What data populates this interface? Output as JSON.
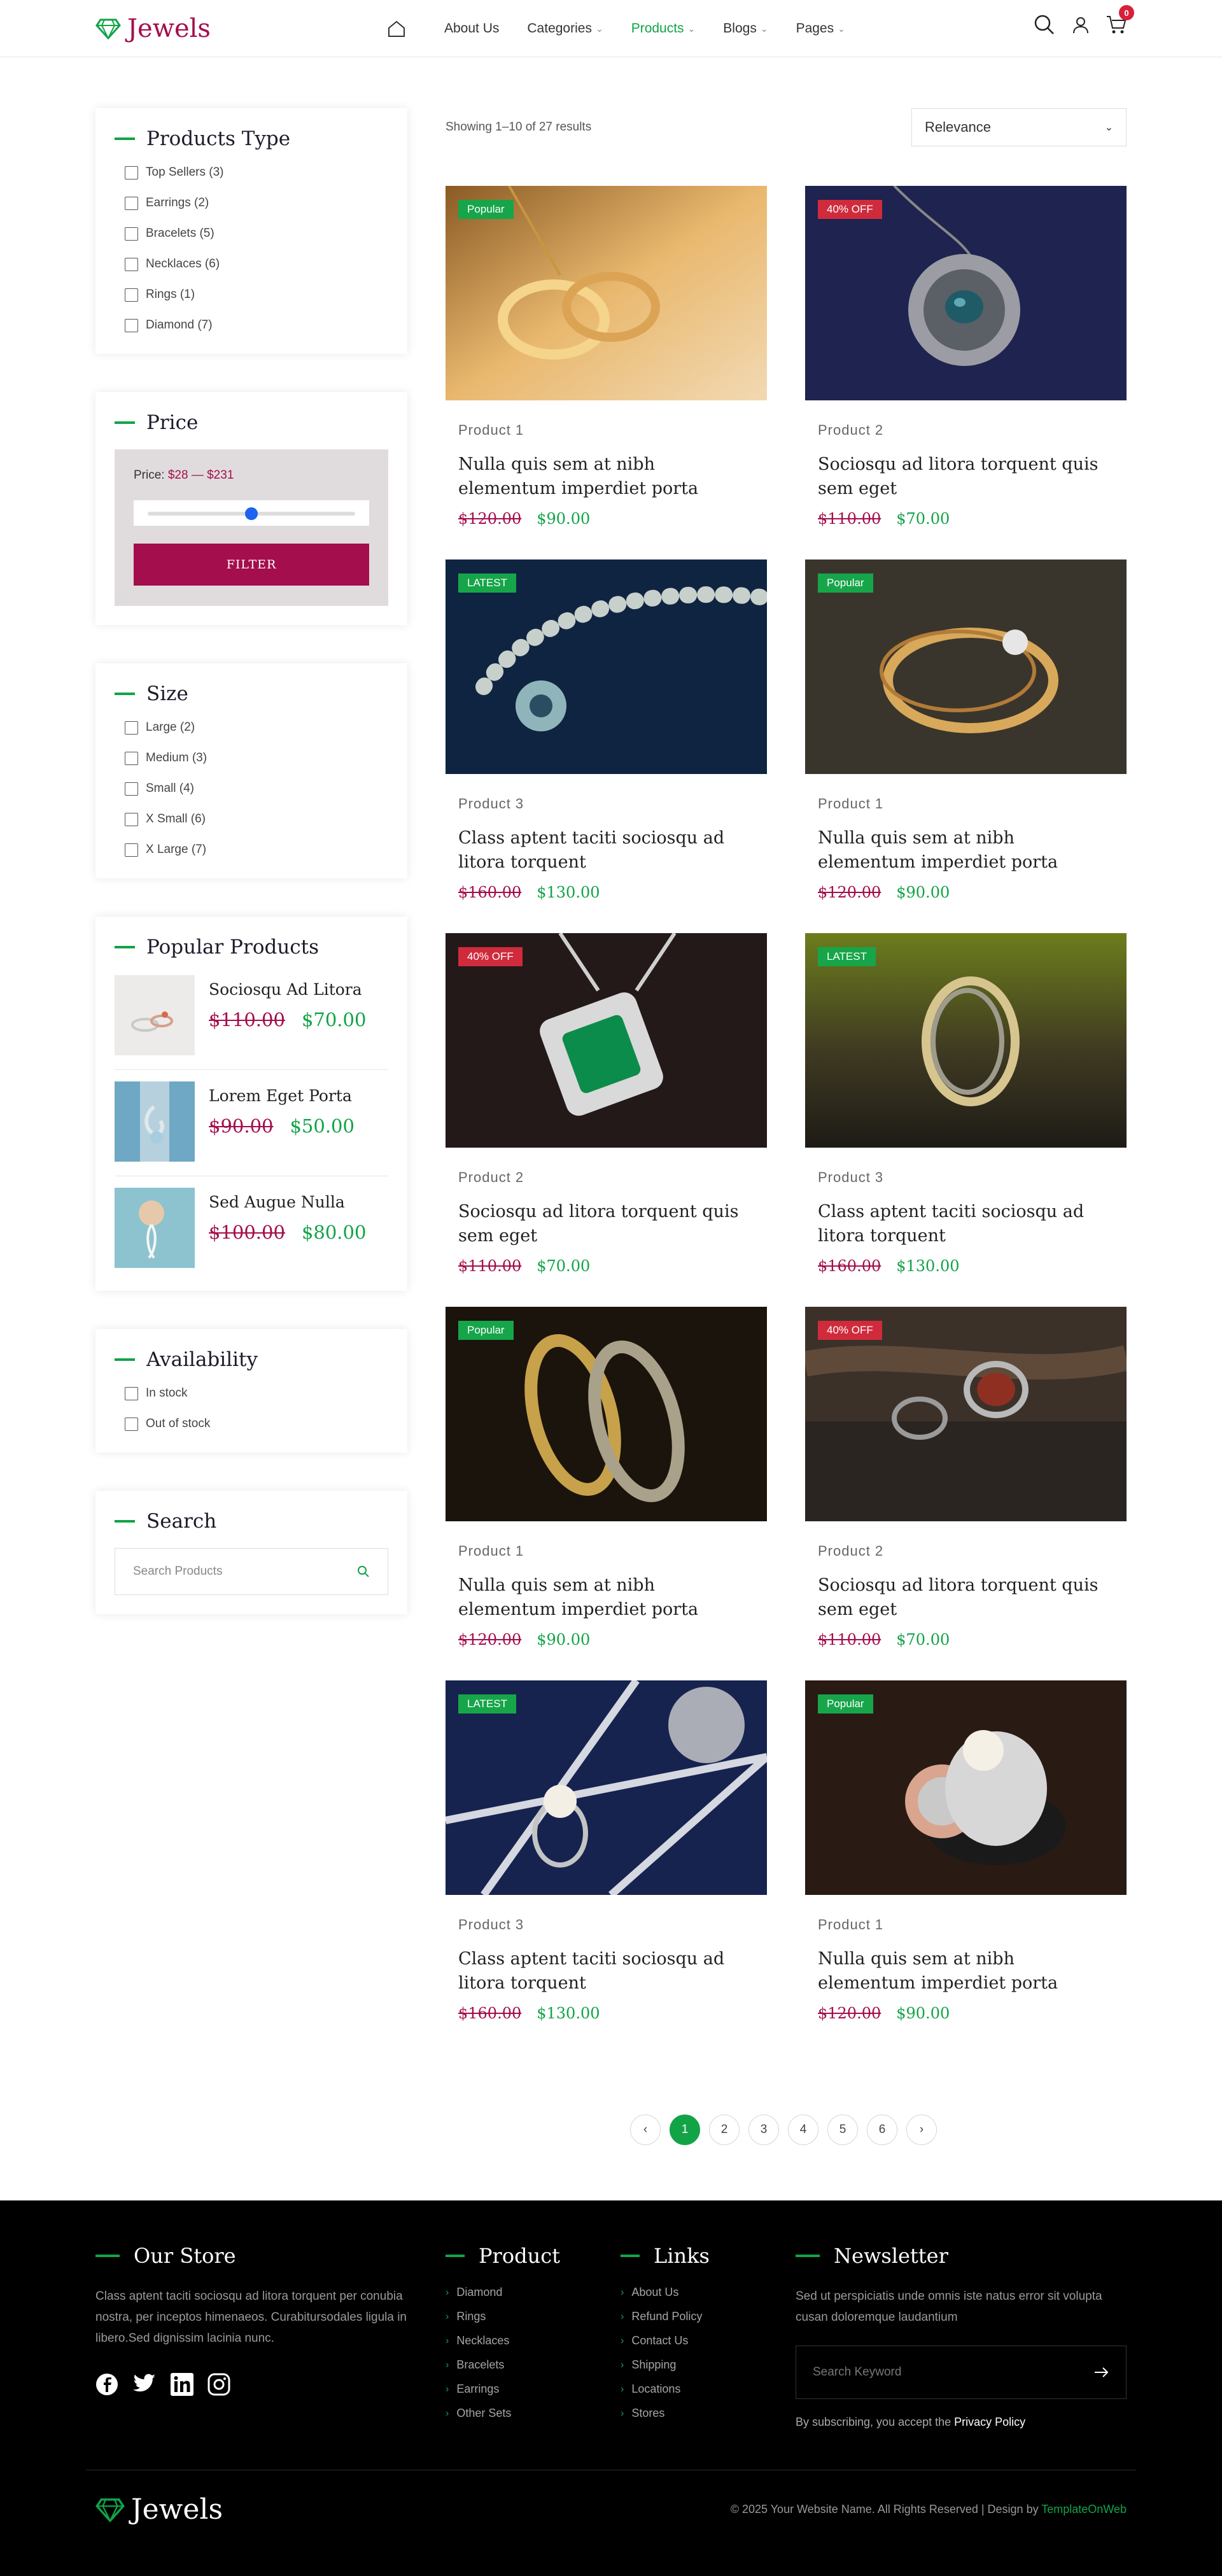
{
  "header": {
    "brand": "Jewels",
    "nav": [
      {
        "label": "About Us",
        "has_menu": false
      },
      {
        "label": "Categories",
        "has_menu": true
      },
      {
        "label": "Products",
        "has_menu": true,
        "active": true
      },
      {
        "label": "Blogs",
        "has_menu": true
      },
      {
        "label": "Pages",
        "has_menu": true
      }
    ],
    "cart_count": "0",
    "icons": [
      "home-icon",
      "search-icon",
      "user-icon",
      "cart-icon"
    ]
  },
  "sidebar": {
    "products_type": {
      "title": "Products Type",
      "options": [
        "Top Sellers (3)",
        "Earrings (2)",
        "Bracelets (5)",
        "Necklaces (6)",
        "Rings (1)",
        "Diamond (7)"
      ]
    },
    "price": {
      "title": "Price",
      "label": "Price:",
      "range": "$28 — $231",
      "slider_level": 0.5,
      "button": "FILTER"
    },
    "size": {
      "title": "Size",
      "options": [
        "Large (2)",
        "Medium (3)",
        "Small (4)",
        "X Small (6)",
        "X Large (7)"
      ]
    },
    "popular": {
      "title": "Popular Products",
      "items": [
        {
          "name": "Sociosqu Ad Litora",
          "old": "$110.00",
          "new": "$70.00"
        },
        {
          "name": "Lorem Eget Porta",
          "old": "$90.00",
          "new": "$50.00"
        },
        {
          "name": "Sed Augue Nulla",
          "old": "$100.00",
          "new": "$80.00"
        }
      ]
    },
    "availability": {
      "title": "Availability",
      "options": [
        "In stock",
        "Out of stock"
      ]
    },
    "search": {
      "title": "Search",
      "placeholder": "Search Products"
    }
  },
  "main": {
    "results": "Showing 1–10 of 27 results",
    "sort": "Relevance",
    "products": [
      {
        "tag": "Popular",
        "tag_color": "green",
        "type": "Product 1",
        "title": "Nulla quis sem at nibh elementum imperdiet porta",
        "old": "$120.00",
        "new": "$90.00"
      },
      {
        "tag": "40% OFF",
        "tag_color": "red",
        "type": "Product 2",
        "title": "Sociosqu ad litora torquent quis sem eget",
        "old": "$110.00",
        "new": "$70.00"
      },
      {
        "tag": "LATEST",
        "tag_color": "green",
        "type": "Product 3",
        "title": "Class aptent taciti sociosqu ad litora torquent",
        "old": "$160.00",
        "new": "$130.00"
      },
      {
        "tag": "Popular",
        "tag_color": "green",
        "type": "Product 1",
        "title": "Nulla quis sem at nibh elementum imperdiet porta",
        "old": "$120.00",
        "new": "$90.00"
      },
      {
        "tag": "40% OFF",
        "tag_color": "red",
        "type": "Product 2",
        "title": "Sociosqu ad litora torquent quis sem eget",
        "old": "$110.00",
        "new": "$70.00"
      },
      {
        "tag": "LATEST",
        "tag_color": "green",
        "type": "Product 3",
        "title": "Class aptent taciti sociosqu ad litora torquent",
        "old": "$160.00",
        "new": "$130.00"
      },
      {
        "tag": "Popular",
        "tag_color": "green",
        "type": "Product 1",
        "title": "Nulla quis sem at nibh elementum imperdiet porta",
        "old": "$120.00",
        "new": "$90.00"
      },
      {
        "tag": "40% OFF",
        "tag_color": "red",
        "type": "Product 2",
        "title": "Sociosqu ad litora torquent quis sem eget",
        "old": "$110.00",
        "new": "$70.00"
      },
      {
        "tag": "LATEST",
        "tag_color": "green",
        "type": "Product 3",
        "title": "Class aptent taciti sociosqu ad litora torquent",
        "old": "$160.00",
        "new": "$130.00"
      },
      {
        "tag": "Popular",
        "tag_color": "green",
        "type": "Product 1",
        "title": "Nulla quis sem at nibh elementum imperdiet porta",
        "old": "$120.00",
        "new": "$90.00"
      }
    ],
    "pagination": [
      "1",
      "2",
      "3",
      "4",
      "5",
      "6"
    ],
    "current_page": "1"
  },
  "footer": {
    "store": {
      "title": "Our Store",
      "text": "Class aptent taciti sociosqu ad litora torquent per conubia nostra, per inceptos himenaeos. Curabitursodales ligula in libero.Sed dignissim lacinia nunc."
    },
    "product": {
      "title": "Product",
      "links": [
        "Diamond",
        "Rings",
        "Necklaces",
        "Bracelets",
        "Earrings",
        "Other Sets"
      ]
    },
    "links": {
      "title": "Links",
      "links": [
        "About Us",
        "Refund Policy",
        "Contact Us",
        "Shipping",
        "Locations",
        "Stores"
      ]
    },
    "newsletter": {
      "title": "Newsletter",
      "text": "Sed ut perspiciatis unde omnis iste natus error sit volupta cusan doloremque laudantium",
      "placeholder": "Search Keyword",
      "note": "By subscribing, you accept the",
      "policy": "Privacy Policy"
    },
    "brand": "Jewels",
    "copyright": "© 2025 Your Website Name. All Rights Reserved | Design by",
    "designer": "TemplateOnWeb",
    "social": [
      "facebook-icon",
      "twitter-icon",
      "linkedin-icon",
      "instagram-icon"
    ]
  },
  "colors": {
    "green": "#12a347",
    "maroon": "#a40e4c",
    "sale_red": "#d02b3c"
  }
}
